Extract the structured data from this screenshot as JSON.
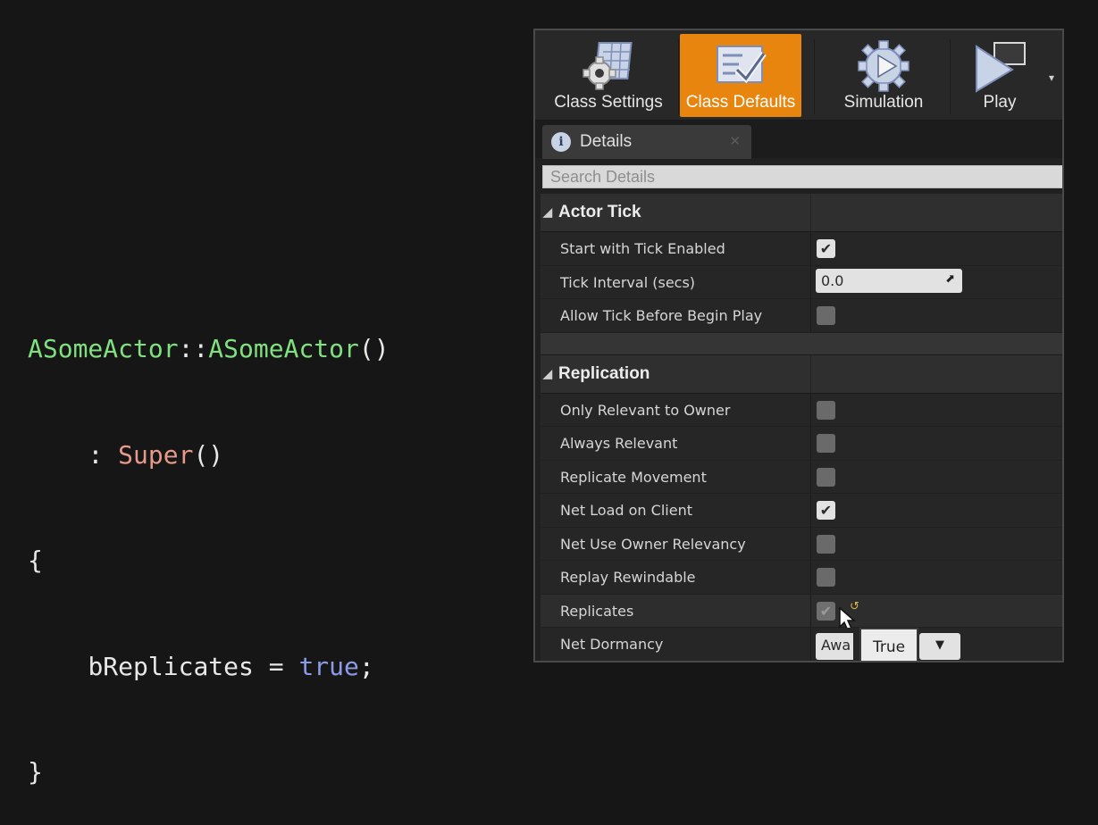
{
  "code": {
    "line1": {
      "cls": "ASomeActor",
      "sep": "::",
      "ctor": "ASomeActor",
      "parens": "()"
    },
    "line2": {
      "indent": "    ",
      "colon": ": ",
      "super": "Super",
      "parens": "()"
    },
    "line3": {
      "text": "{"
    },
    "line4": {
      "indent": "    ",
      "lhs": "bReplicates = ",
      "value": "true",
      "semi": ";"
    },
    "line5": {
      "text": "}"
    }
  },
  "toolbar": {
    "class_settings": "Class Settings",
    "class_defaults": "Class Defaults",
    "simulation": "Simulation",
    "play": "Play",
    "more": "▾"
  },
  "details_tab": {
    "label": "Details",
    "icon": "i",
    "close": "✕"
  },
  "search": {
    "placeholder": "Search Details"
  },
  "actor_tick": {
    "title": "Actor Tick",
    "start_with_tick_enabled": {
      "label": "Start with Tick Enabled",
      "checked": true
    },
    "tick_interval": {
      "label": "Tick Interval (secs)",
      "value": "0.0"
    },
    "allow_tick_before_begin_play": {
      "label": "Allow Tick Before Begin Play",
      "checked": false
    }
  },
  "replication": {
    "title": "Replication",
    "only_relevant_to_owner": {
      "label": "Only Relevant to Owner",
      "checked": false
    },
    "always_relevant": {
      "label": "Always Relevant",
      "checked": false
    },
    "replicate_movement": {
      "label": "Replicate Movement",
      "checked": false
    },
    "net_load_on_client": {
      "label": "Net Load on Client",
      "checked": true
    },
    "net_use_owner_relevancy": {
      "label": "Net Use Owner Relevancy",
      "checked": false
    },
    "replay_rewindable": {
      "label": "Replay Rewindable",
      "checked": false
    },
    "replicates": {
      "label": "Replicates",
      "checked": true,
      "reset_icon": "↺"
    },
    "net_dormancy": {
      "label": "Net Dormancy",
      "value": "Awa"
    }
  },
  "tooltip": {
    "text": "True"
  },
  "colors": {
    "accent": "#e8850f",
    "panel_bg": "#202020",
    "class_token": "#7fe27f",
    "super_token": "#e79a8a",
    "keyword_token": "#8b9be8"
  }
}
